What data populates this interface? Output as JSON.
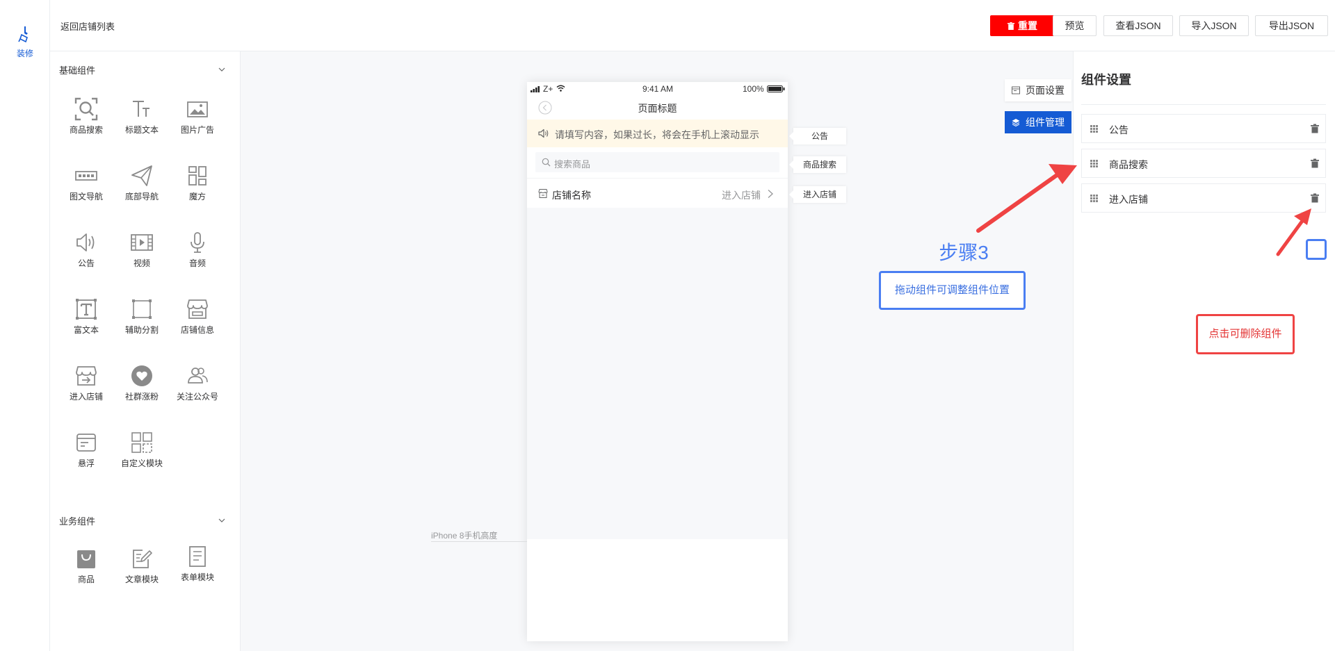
{
  "rail": {
    "decor_label": "装修"
  },
  "header": {
    "back_label": "返回店铺列表",
    "buttons": {
      "reset": "重置",
      "preview": "预览",
      "view_json": "查看JSON",
      "import_json": "导入JSON",
      "export_json": "导出JSON"
    }
  },
  "palette": {
    "basic_title": "基础组件",
    "basic_items": [
      {
        "label": "商品搜索",
        "icon": "search-icon"
      },
      {
        "label": "标题文本",
        "icon": "title-text-icon"
      },
      {
        "label": "图片广告",
        "icon": "image-ad-icon"
      },
      {
        "label": "图文导航",
        "icon": "image-nav-icon"
      },
      {
        "label": "底部导航",
        "icon": "paper-plane-icon"
      },
      {
        "label": "魔方",
        "icon": "cube-layout-icon"
      },
      {
        "label": "公告",
        "icon": "speaker-icon"
      },
      {
        "label": "视频",
        "icon": "video-icon"
      },
      {
        "label": "音频",
        "icon": "microphone-icon"
      },
      {
        "label": "富文本",
        "icon": "rich-text-icon"
      },
      {
        "label": "辅助分割",
        "icon": "divider-icon"
      },
      {
        "label": "店铺信息",
        "icon": "store-info-icon"
      },
      {
        "label": "进入店铺",
        "icon": "enter-store-icon"
      },
      {
        "label": "社群涨粉",
        "icon": "community-icon"
      },
      {
        "label": "关注公众号",
        "icon": "follow-account-icon"
      },
      {
        "label": "悬浮",
        "icon": "float-icon"
      },
      {
        "label": "自定义模块",
        "icon": "custom-module-icon"
      }
    ],
    "business_title": "业务组件",
    "business_items": [
      {
        "label": "商品",
        "icon": "shopping-bag-icon"
      },
      {
        "label": "文章模块",
        "icon": "article-icon"
      },
      {
        "label": "表单模块",
        "icon": "form-icon"
      }
    ]
  },
  "phone": {
    "status_carrier": "Z+",
    "status_time": "9:41 AM",
    "status_battery": "100%",
    "page_title": "页面标题",
    "notice_text": "请填写内容，如果过长，将会在手机上滚动显示",
    "search_placeholder": "搜索商品",
    "store_name": "店铺名称",
    "enter_store": "进入店铺"
  },
  "canvas": {
    "tags": [
      "公告",
      "商品搜索",
      "进入店铺"
    ],
    "iphone_label": "iPhone 8手机高度",
    "page_settings": "页面设置",
    "component_manage": "组件管理",
    "step_title": "步骤3",
    "step_hint": "拖动组件可调整组件位置"
  },
  "settings": {
    "title": "组件设置",
    "components": [
      "公告",
      "商品搜索",
      "进入店铺"
    ],
    "delete_hint": "点击可删除组件"
  },
  "colors": {
    "brand": "#155bd4",
    "danger": "#ff0000",
    "annotation_blue": "#4a7ef2",
    "annotation_red": "#ef4343",
    "notice_bg": "#fff8e8"
  }
}
